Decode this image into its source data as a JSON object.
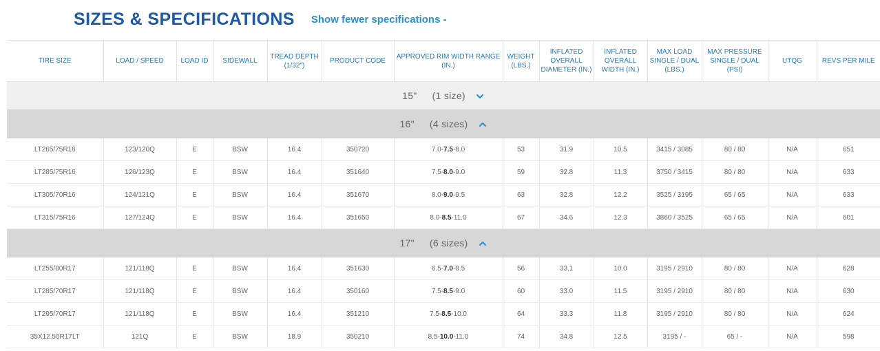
{
  "header": {
    "title": "SIZES & SPECIFICATIONS",
    "toggle_link": "Show fewer specifications -"
  },
  "columns": [
    "TIRE SIZE",
    "LOAD / SPEED",
    "LOAD ID",
    "SIDEWALL",
    "TREAD DEPTH (1/32\")",
    "PRODUCT CODE",
    "APPROVED RIM WIDTH RANGE (IN.)",
    "WEIGHT (LBS.)",
    "INFLATED OVERALL DIAMETER (IN.)",
    "INFLATED OVERALL WIDTH (IN.)",
    "MAX LOAD SINGLE / DUAL (LBS.)",
    "MAX PRESSURE SINGLE / DUAL (PSI)",
    "UTQG",
    "REVS PER MILE"
  ],
  "groups": [
    {
      "size": "15\"",
      "count": "(1 size)",
      "expanded": false,
      "rows": []
    },
    {
      "size": "16\"",
      "count": "(4 sizes)",
      "expanded": true,
      "rows": [
        {
          "tire_size": "LT265/75R16",
          "load_speed": "123/120Q",
          "load_id": "E",
          "sidewall": "BSW",
          "tread_depth": "16.4",
          "product_code": "350720",
          "rim_min": "7.0-",
          "rim_mid": "7.5",
          "rim_max": "-8.0",
          "weight": "53",
          "diameter": "31.9",
          "width": "10.5",
          "max_load": "3415 / 3085",
          "max_pressure": "80 / 80",
          "utqg": "N/A",
          "revs": "651"
        },
        {
          "tire_size": "LT285/75R16",
          "load_speed": "126/123Q",
          "load_id": "E",
          "sidewall": "BSW",
          "tread_depth": "16.4",
          "product_code": "351640",
          "rim_min": "7.5-",
          "rim_mid": "8.0",
          "rim_max": "-9.0",
          "weight": "59",
          "diameter": "32.8",
          "width": "11.3",
          "max_load": "3750 / 3415",
          "max_pressure": "80 / 80",
          "utqg": "N/A",
          "revs": "633"
        },
        {
          "tire_size": "LT305/70R16",
          "load_speed": "124/121Q",
          "load_id": "E",
          "sidewall": "BSW",
          "tread_depth": "16.4",
          "product_code": "351670",
          "rim_min": "8.0-",
          "rim_mid": "9.0",
          "rim_max": "-9.5",
          "weight": "63",
          "diameter": "32.8",
          "width": "12.2",
          "max_load": "3525 / 3195",
          "max_pressure": "65 / 65",
          "utqg": "N/A",
          "revs": "633"
        },
        {
          "tire_size": "LT315/75R16",
          "load_speed": "127/124Q",
          "load_id": "E",
          "sidewall": "BSW",
          "tread_depth": "16.4",
          "product_code": "351650",
          "rim_min": "8.0-",
          "rim_mid": "8.5",
          "rim_max": "-11.0",
          "weight": "67",
          "diameter": "34.6",
          "width": "12.3",
          "max_load": "3860 / 3525",
          "max_pressure": "65 / 65",
          "utqg": "N/A",
          "revs": "601"
        }
      ]
    },
    {
      "size": "17\"",
      "count": "(6 sizes)",
      "expanded": true,
      "rows": [
        {
          "tire_size": "LT255/80R17",
          "load_speed": "121/118Q",
          "load_id": "E",
          "sidewall": "BSW",
          "tread_depth": "16.4",
          "product_code": "351630",
          "rim_min": "6.5-",
          "rim_mid": "7.0",
          "rim_max": "-8.5",
          "weight": "56",
          "diameter": "33.1",
          "width": "10.0",
          "max_load": "3195 / 2910",
          "max_pressure": "80 / 80",
          "utqg": "N/A",
          "revs": "628"
        },
        {
          "tire_size": "LT285/70R17",
          "load_speed": "121/118Q",
          "load_id": "E",
          "sidewall": "BSW",
          "tread_depth": "16.4",
          "product_code": "350160",
          "rim_min": "7.5-",
          "rim_mid": "8.5",
          "rim_max": "-9.0",
          "weight": "60",
          "diameter": "33.0",
          "width": "11.5",
          "max_load": "3195 / 2910",
          "max_pressure": "80 / 80",
          "utqg": "N/A",
          "revs": "630"
        },
        {
          "tire_size": "LT295/70R17",
          "load_speed": "121/118Q",
          "load_id": "E",
          "sidewall": "BSW",
          "tread_depth": "16.4",
          "product_code": "351210",
          "rim_min": "7.5-",
          "rim_mid": "8.5",
          "rim_max": "-10.0",
          "weight": "64",
          "diameter": "33.3",
          "width": "11.8",
          "max_load": "3195 / 2910",
          "max_pressure": "80 / 80",
          "utqg": "N/A",
          "revs": "624"
        },
        {
          "tire_size": "35X12.50R17LT",
          "load_speed": "121Q",
          "load_id": "E",
          "sidewall": "BSW",
          "tread_depth": "18.9",
          "product_code": "350210",
          "rim_min": "8.5-",
          "rim_mid": "10.0",
          "rim_max": "-11.0",
          "weight": "74",
          "diameter": "34.8",
          "width": "12.5",
          "max_load": "3195 / -",
          "max_pressure": "65 / -",
          "utqg": "N/A",
          "revs": "598"
        }
      ]
    }
  ],
  "icons": {
    "chevron_color": "#2a8fd0"
  }
}
